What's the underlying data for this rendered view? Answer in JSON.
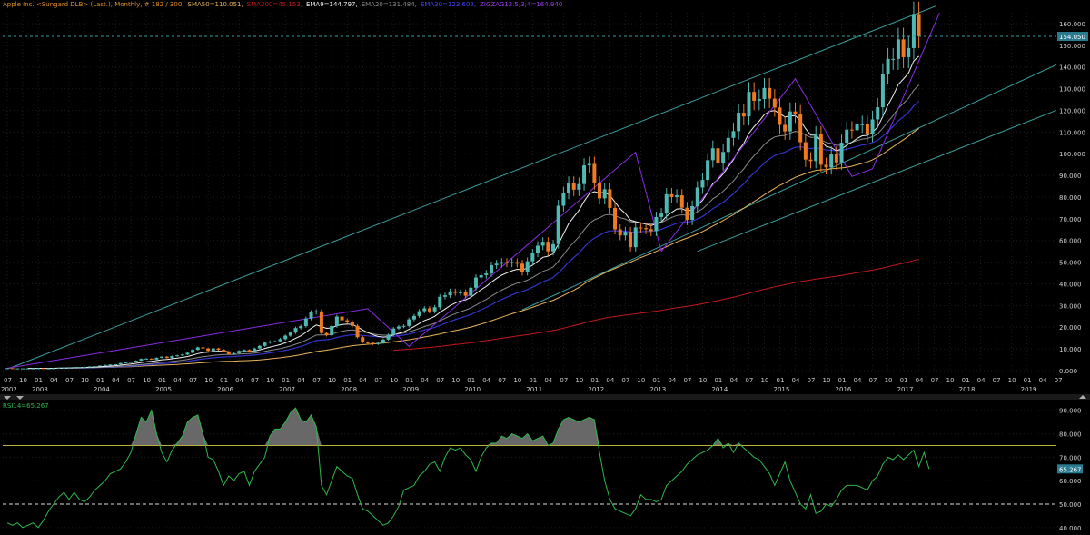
{
  "header": {
    "title": "Apple Inc.  <Sungard DLB> (Last.), Monthly, # 182 / 300,",
    "sma50": "SMA50=110.051,",
    "sma200": "SMA200=45.153,",
    "ema9": "EMA9=144.797,",
    "ema20": "EMA20=131.484,",
    "ema30": "EMA30=123.602,",
    "zigzag": "ZIGZAG12.5;3;4=164.940"
  },
  "colors": {
    "background": "#000000",
    "up_candle": "#4fb9b3",
    "down_candle": "#f07a21",
    "sma50": "#e8b45a",
    "sma200": "#c1181c",
    "ema9": "#f2f2f2",
    "ema20": "#8a8a8a",
    "ema30": "#3333cc",
    "zigzag": "#8a2be2",
    "channel": "#3a9c9c",
    "rsi": "#2fb84c",
    "rsi_upper": "#b9b040",
    "grid": "#1c1c1c"
  },
  "price_axis": {
    "ticks": [
      "160.000",
      "150.000",
      "140.000",
      "130.000",
      "120.000",
      "110.000",
      "100.000",
      "90.000",
      "80.000",
      "70.000",
      "60.000",
      "50.000",
      "40.000",
      "30.000",
      "20.000",
      "10.000",
      "0.000"
    ],
    "last_price_label": "154.050"
  },
  "time_axis": {
    "month_ticks": [
      "07",
      "10",
      "01",
      "04",
      "07",
      "10",
      "01",
      "04",
      "07",
      "10",
      "01",
      "04",
      "07",
      "10",
      "01",
      "04",
      "07",
      "10",
      "01",
      "04",
      "07",
      "10",
      "01",
      "04",
      "07",
      "10",
      "01",
      "04",
      "07",
      "10",
      "01",
      "04",
      "07",
      "10",
      "01",
      "04",
      "07",
      "10",
      "01",
      "04",
      "07",
      "10",
      "01",
      "04",
      "07",
      "10",
      "01",
      "04",
      "07",
      "10",
      "01",
      "04",
      "07",
      "10",
      "01",
      "04",
      "07",
      "10",
      "01",
      "04",
      "07",
      "10",
      "01",
      "04",
      "07",
      "10",
      "01",
      "04",
      "07"
    ],
    "year_labels": [
      "2002",
      "2003",
      "2004",
      "2005",
      "2006",
      "2007",
      "2008",
      "2009",
      "2010",
      "2011",
      "2012",
      "2013",
      "2014",
      "2015",
      "2016",
      "2017",
      "2018",
      "2019"
    ]
  },
  "rsi": {
    "label": "RSI14=65.267",
    "value_label": "65.267",
    "ticks": [
      "90.000",
      "80.000",
      "70.000",
      "60.000",
      "50.000",
      "40.000"
    ],
    "upper_level": 75,
    "lower_level": 50
  },
  "chart_data": [
    {
      "type": "candlestick",
      "interval": "monthly",
      "x_start": "2002-07",
      "ylim": [
        0,
        165
      ],
      "grid": true,
      "close": [
        1.1,
        0.9,
        1.0,
        1.0,
        1.0,
        1.0,
        1.1,
        1.0,
        1.0,
        1.1,
        1.3,
        1.4,
        1.5,
        1.6,
        1.6,
        1.7,
        1.9,
        2.0,
        2.3,
        2.6,
        2.8,
        2.9,
        3.5,
        3.8,
        4.0,
        4.6,
        5.4,
        5.5,
        5.1,
        5.9,
        6.4,
        5.8,
        6.7,
        7.0,
        7.4,
        8.2,
        9.6,
        10.7,
        10.2,
        9.1,
        10.2,
        9.6,
        8.7,
        7.6,
        8.0,
        9.1,
        9.5,
        8.6,
        10.2,
        11.4,
        12.9,
        13.4,
        13.5,
        14.5,
        16.1,
        17.5,
        19.6,
        20.5,
        24.0,
        26.8,
        27.3,
        17.3,
        16.3,
        20.5,
        24.9,
        23.2,
        22.4,
        20.6,
        15.4,
        13.1,
        12.8,
        12.2,
        12.8,
        14.3,
        16.5,
        19.4,
        20.3,
        20.6,
        23.6,
        25.2,
        27.4,
        28.7,
        27.3,
        29.2,
        34.0,
        34.7,
        36.5,
        35.8,
        36.1,
        34.5,
        38.2,
        42.9,
        44.0,
        44.8,
        48.6,
        49.3,
        50.0,
        49.4,
        50.0,
        49.3,
        45.4,
        50.4,
        54.2,
        57.6,
        59.4,
        55.0,
        58.3,
        76.0,
        81.9,
        86.5,
        83.4,
        86.0,
        94.6,
        95.3,
        86.5,
        79.4,
        83.6,
        75.0,
        65.1,
        62.3,
        64.0,
        56.9,
        66.0,
        65.7,
        65.2,
        64.3,
        70.8,
        72.4,
        81.3,
        80.0,
        80.8,
        75.1,
        69.5,
        75.8,
        84.4,
        87.9,
        97.0,
        102.5,
        95.6,
        100.8,
        107.3,
        110.4,
        118.9,
        117.2,
        128.5,
        124.4,
        125.2,
        130.3,
        125.4,
        121.3,
        113.3,
        110.3,
        119.5,
        118.3,
        105.3,
        97.3,
        96.6,
        108.9,
        94.9,
        93.7,
        99.9,
        96.0,
        105.1,
        111.1,
        110.8,
        113.5,
        113.6,
        109.2,
        115.8,
        121.4,
        136.9,
        143.7,
        143.7,
        152.7,
        144.5,
        148.7,
        164.4,
        154.1
      ],
      "rsi14": [
        42,
        41,
        42,
        40,
        41,
        42,
        40,
        43,
        47,
        50,
        53,
        55,
        52,
        55,
        52,
        51,
        53,
        56,
        58,
        60,
        63,
        64,
        65,
        68,
        72,
        80,
        87,
        85,
        90,
        80,
        72,
        68,
        73,
        76,
        79,
        85,
        87,
        88,
        80,
        70,
        69,
        64,
        58,
        62,
        60,
        63,
        64,
        58,
        64,
        67,
        70,
        79,
        82,
        82,
        85,
        89,
        91,
        86,
        85,
        88,
        83,
        58,
        54,
        60,
        66,
        64,
        62,
        61,
        54,
        48,
        47,
        45,
        43,
        41,
        42,
        45,
        49,
        56,
        57,
        58,
        62,
        64,
        67,
        68,
        64,
        70,
        74,
        73,
        74,
        71,
        69,
        64,
        70,
        74,
        76,
        76,
        79,
        78,
        80,
        79,
        78,
        80,
        77,
        78,
        79,
        75,
        76,
        82,
        86,
        87,
        86,
        85,
        86,
        87,
        86,
        72,
        60,
        52,
        48,
        47,
        46,
        45,
        48,
        54,
        52,
        52,
        51,
        52,
        58,
        60,
        62,
        64,
        67,
        69,
        71,
        72,
        73,
        75,
        78,
        74,
        76,
        72,
        76,
        74,
        72,
        70,
        69,
        66,
        63,
        58,
        63,
        68,
        60,
        55,
        50,
        48,
        54,
        46,
        47,
        50,
        49,
        52,
        56,
        58,
        58,
        58,
        57,
        56,
        60,
        62,
        67,
        70,
        69,
        71,
        69,
        71,
        73,
        66,
        72,
        65
      ]
    },
    {
      "type": "line",
      "panel": "RSI",
      "series": [
        {
          "name": "RSI14",
          "values_ref": "rsi14"
        }
      ],
      "ylim": [
        38,
        93
      ]
    }
  ]
}
